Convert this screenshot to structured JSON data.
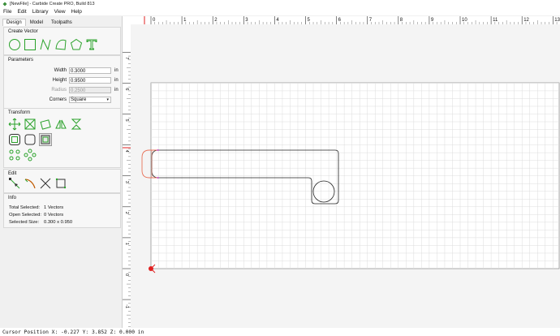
{
  "window": {
    "title": "[NewFile] - Carbide Create PRO, Build 813"
  },
  "menu": [
    "File",
    "Edit",
    "Library",
    "View",
    "Help"
  ],
  "tabs": [
    "Design",
    "Model",
    "Toolpaths"
  ],
  "sections": {
    "create_vector": "Create Vector",
    "parameters": "Parameters",
    "transform": "Transform",
    "edit": "Edit",
    "info": "Info"
  },
  "parameters": {
    "width": {
      "label": "Width",
      "value": "0.3000",
      "unit": "in"
    },
    "height": {
      "label": "Height",
      "value": "0.9500",
      "unit": "in"
    },
    "radius": {
      "label": "Radius",
      "value": "0.2500",
      "unit": "in"
    },
    "corners": {
      "label": "Corners",
      "value": "Square"
    }
  },
  "info": {
    "total_selected": {
      "label": "Total Selected:",
      "value": "1 Vectors"
    },
    "open_selected": {
      "label": "Open Selected:",
      "value": "0 Vectors"
    },
    "selected_size": {
      "label": "Selected Size:",
      "value": "0.300 x 0.950"
    }
  },
  "ruler": {
    "top_labels": [
      "0",
      "1",
      "2",
      "3",
      "4",
      "5",
      "6",
      "7",
      "8",
      "9",
      "10",
      "11",
      "12",
      "13"
    ],
    "left_labels": [
      "7",
      "6",
      "5",
      "4",
      "3",
      "2",
      "1",
      "0",
      "-1"
    ]
  },
  "colors": {
    "accent_green": "#2aa12a",
    "selection": "#e8735a",
    "panel": "#f0f0f0"
  },
  "status": {
    "cursor_position": "Cursor Position X: -0.227 Y: 3.852 Z: 0.000 in"
  }
}
